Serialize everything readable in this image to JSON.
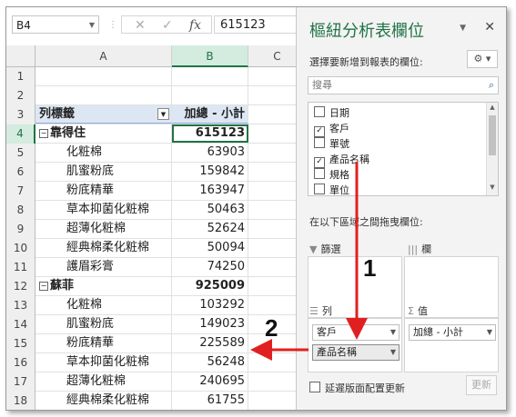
{
  "formula_bar": {
    "name_box": "B4",
    "value": "615123",
    "fx": "fx",
    "cancel": "✕",
    "enter": "✓"
  },
  "columns": [
    "A",
    "B",
    "C"
  ],
  "rows": [
    {
      "num": "1",
      "a": "",
      "b": "",
      "kind": "empty"
    },
    {
      "num": "2",
      "a": "",
      "b": "",
      "kind": "empty"
    },
    {
      "num": "3",
      "a": "列標籤",
      "b": "加總 - 小計",
      "kind": "header"
    },
    {
      "num": "4",
      "a": "靠得住",
      "b": "615123",
      "kind": "group"
    },
    {
      "num": "5",
      "a": "化粧棉",
      "b": "63903",
      "kind": "item"
    },
    {
      "num": "6",
      "a": "肌蜜粉底",
      "b": "159842",
      "kind": "item"
    },
    {
      "num": "7",
      "a": "粉底精華",
      "b": "163947",
      "kind": "item"
    },
    {
      "num": "8",
      "a": "草本抑菌化粧棉",
      "b": "50463",
      "kind": "item"
    },
    {
      "num": "9",
      "a": "超薄化粧棉",
      "b": "52624",
      "kind": "item"
    },
    {
      "num": "10",
      "a": "經典棉柔化粧棉",
      "b": "50094",
      "kind": "item"
    },
    {
      "num": "11",
      "a": "護眉彩膏",
      "b": "74250",
      "kind": "item"
    },
    {
      "num": "12",
      "a": "蘇菲",
      "b": "925009",
      "kind": "group"
    },
    {
      "num": "13",
      "a": "化粧棉",
      "b": "103292",
      "kind": "item"
    },
    {
      "num": "14",
      "a": "肌蜜粉底",
      "b": "149023",
      "kind": "item"
    },
    {
      "num": "15",
      "a": "粉底精華",
      "b": "225589",
      "kind": "item"
    },
    {
      "num": "16",
      "a": "草本抑菌化粧棉",
      "b": "56248",
      "kind": "item"
    },
    {
      "num": "17",
      "a": "超薄化粧棉",
      "b": "240695",
      "kind": "item"
    },
    {
      "num": "18",
      "a": "經典棉柔化粧棉",
      "b": "61755",
      "kind": "item"
    }
  ],
  "panel": {
    "title": "樞紐分析表欄位",
    "choose_label": "選擇要新增到報表的欄位:",
    "search_placeholder": "搜尋",
    "fields": [
      {
        "label": "日期",
        "checked": false
      },
      {
        "label": "客戶",
        "checked": true
      },
      {
        "label": "單號",
        "checked": false
      },
      {
        "label": "產品名稱",
        "checked": true
      },
      {
        "label": "規格",
        "checked": false
      },
      {
        "label": "單位",
        "checked": false
      }
    ],
    "drag_label": "在以下區域之間拖曳欄位:",
    "filters_label": "篩選",
    "columns_label": "欄",
    "rows_label": "列",
    "values_label": "值",
    "rows_items": [
      "客戶",
      "產品名稱"
    ],
    "values_items": [
      "加總 - 小計"
    ],
    "defer_label": "延遲版面配置更新",
    "update_label": "更新"
  },
  "annotations": {
    "step1": "1",
    "step2": "2",
    "arrow_color": "#e02020"
  }
}
